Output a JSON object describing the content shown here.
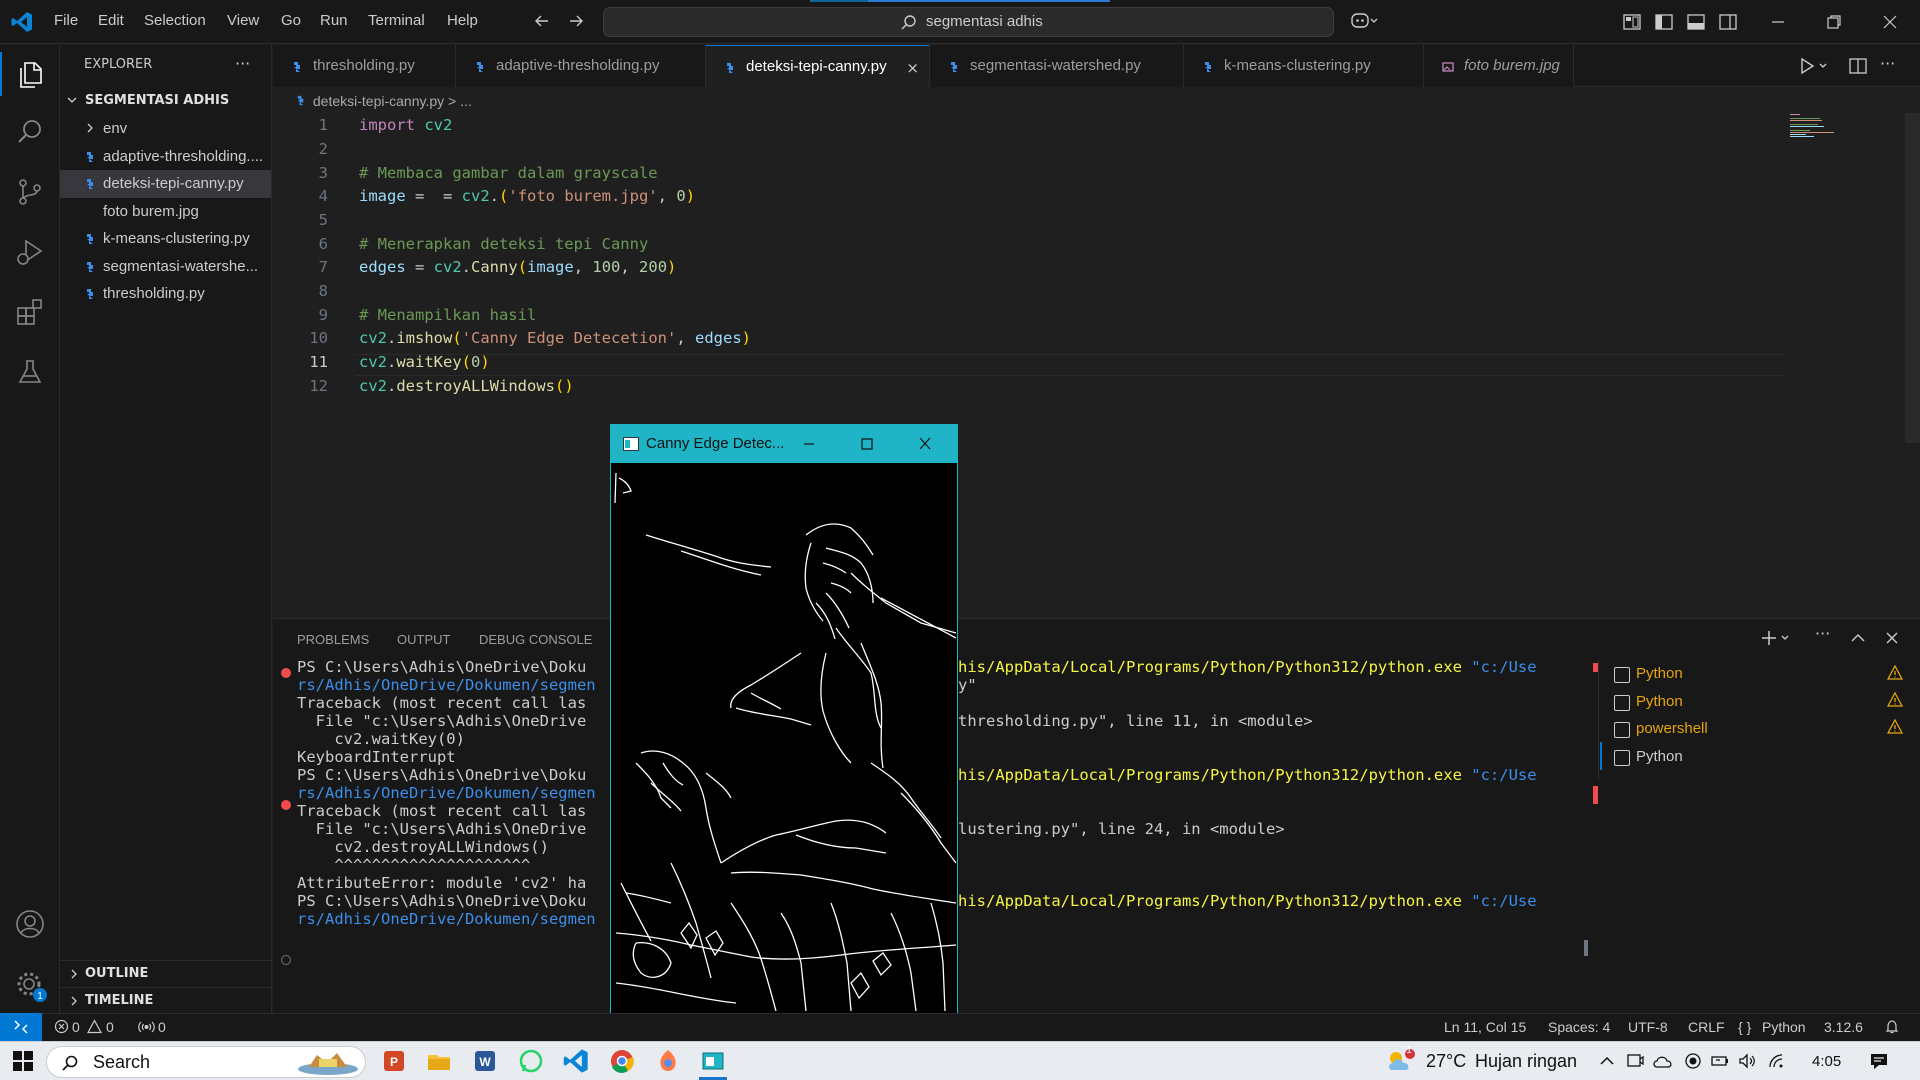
{
  "titlebar": {
    "menus": [
      "File",
      "Edit",
      "Selection",
      "View",
      "Go",
      "Run",
      "Terminal",
      "Help"
    ],
    "search_text": "segmentasi adhis"
  },
  "explorer": {
    "title": "EXPLORER",
    "more": "···",
    "folder": "SEGMENTASI ADHIS",
    "items": [
      {
        "label": "env",
        "type": "folder"
      },
      {
        "label": "adaptive-thresholding....",
        "type": "py"
      },
      {
        "label": "deteksi-tepi-canny.py",
        "type": "py",
        "active": true
      },
      {
        "label": "foto burem.jpg",
        "type": "img"
      },
      {
        "label": "k-means-clustering.py",
        "type": "py"
      },
      {
        "label": "segmentasi-watershe...",
        "type": "py"
      },
      {
        "label": "thresholding.py",
        "type": "py"
      }
    ],
    "outline": "OUTLINE",
    "timeline": "TIMELINE"
  },
  "tabs": [
    {
      "label": "thresholding.py"
    },
    {
      "label": "adaptive-thresholding.py"
    },
    {
      "label": "deteksi-tepi-canny.py",
      "active": true,
      "close": "×"
    },
    {
      "label": "segmentasi-watershed.py"
    },
    {
      "label": "k-means-clustering.py"
    },
    {
      "label": "foto burem.jpg"
    }
  ],
  "breadcrumb": "deteksi-tepi-canny.py > ...",
  "editor": {
    "line_numbers": [
      "1",
      "2",
      "3",
      "4",
      "5",
      "6",
      "7",
      "8",
      "9",
      "10",
      "11",
      "12"
    ],
    "current_line": 11
  },
  "panel": {
    "tabs": [
      "PROBLEMS",
      "OUTPUT",
      "DEBUG CONSOLE"
    ],
    "terminal_left": [
      "PS C:\\Users\\Adhis\\OneDrive\\Doku",
      "rs/Adhis/OneDrive/Dokumen/segmen",
      "Traceback (most recent call las",
      "  File \"c:\\Users\\Adhis\\OneDrive",
      "    cv2.waitKey(0)",
      "KeyboardInterrupt",
      "PS C:\\Users\\Adhis\\OneDrive\\Doku",
      "rs/Adhis/OneDrive/Dokumen/segmen",
      "Traceback (most recent call las",
      "  File \"c:\\Users\\Adhis\\OneDrive",
      "    cv2.destroyALLWindows()",
      "    ^^^^^^^^^^^^^^^^^^^^^",
      "AttributeError: module 'cv2' ha",
      "PS C:\\Users\\Adhis\\OneDrive\\Doku",
      "rs/Adhis/OneDrive/Dokumen/segmen"
    ],
    "terminal_right": [
      {
        "row": 0,
        "text": "his/AppData/Local/Programs/Python/Python312/python.exe \"c:/Use"
      },
      {
        "row": 1,
        "text": "y\""
      },
      {
        "row": 3,
        "text": "thresholding.py\", line 11, in <module>"
      },
      {
        "row": 6,
        "text": "his/AppData/Local/Programs/Python/Python312/python.exe \"c:/Use"
      },
      {
        "row": 9,
        "text": "lustering.py\", line 24, in <module>"
      },
      {
        "row": 13,
        "text": "his/AppData/Local/Programs/Python/Python312/python.exe \"c:/Use"
      }
    ],
    "terminals": [
      {
        "label": "Python",
        "color": "#e5a50a",
        "warn": true
      },
      {
        "label": "Python",
        "color": "#e5a50a",
        "warn": true
      },
      {
        "label": "powershell",
        "color": "#e5a50a",
        "warn": true
      },
      {
        "label": "Python",
        "color": "#cccccc",
        "warn": false
      }
    ]
  },
  "canny_window": {
    "title": "Canny Edge Detec..."
  },
  "statusbar": {
    "errors": "0",
    "warnings": "0",
    "ports": "0",
    "position": "Ln 11, Col 15",
    "spaces": "Spaces: 4",
    "encoding": "UTF-8",
    "eol": "CRLF",
    "language": "Python",
    "version": "3.12.6"
  },
  "taskbar": {
    "search": "Search",
    "weather_temp": "27°C",
    "weather_desc": "Hujan ringan",
    "weather_badge": "1",
    "time": "4:05"
  },
  "colors": {
    "accent": "#0078d4",
    "canny_titlebar": "#1fb5c7",
    "error": "#f14c4c",
    "warning": "#e5a50a"
  }
}
